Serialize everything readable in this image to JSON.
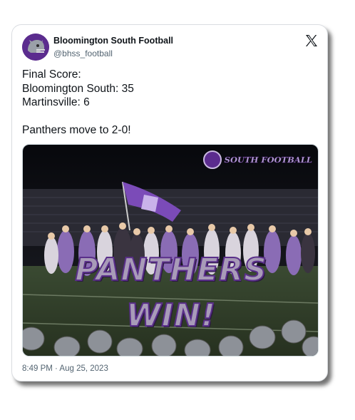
{
  "tweet": {
    "display_name": "Bloomington South Football",
    "handle": "@bhss_football",
    "text_lines": [
      "Final Score:",
      "Bloomington South: 35",
      "Martinsville: 6",
      "",
      "Panthers move to 2-0!"
    ],
    "timestamp": "8:49 PM · Aug 25, 2023",
    "platform_icon": "x-logo-icon",
    "avatar_icon": "panther-helmet-icon"
  },
  "media": {
    "image_label": "celebration-photo",
    "overlay_line_1": "PANTHERS",
    "overlay_line_2": "WIN!",
    "brand_text": "SOUTH FOOTBALL"
  },
  "colors": {
    "brand_purple": "#5b2c8e",
    "text_primary": "#0f1419",
    "text_secondary": "#536471",
    "overlay_text": "#a89bb8"
  }
}
